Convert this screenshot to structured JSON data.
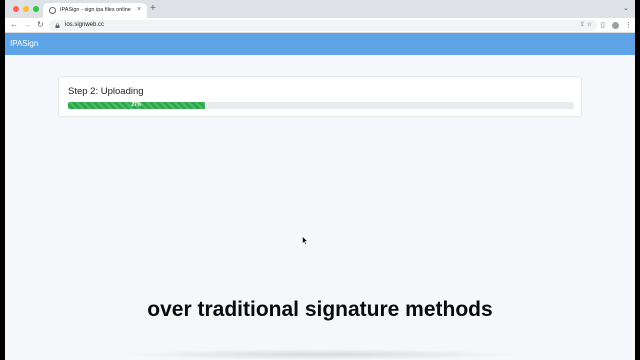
{
  "browser": {
    "tab_title": "IPASign - sign ipa files online",
    "tab_close": "×",
    "new_tab": "+",
    "tab_expand": "⌄",
    "url": "ios.signweb.cc",
    "nav": {
      "back": "←",
      "forward": "→",
      "reload": "↻"
    },
    "omnibox_icons": "⇪ ☆",
    "toolbar": {
      "side_panel": "▯",
      "menu": "⋮"
    }
  },
  "app": {
    "brand": "IPASign",
    "navbar_color": "#5ea3e6"
  },
  "upload": {
    "step_title": "Step 2: Uploading",
    "progress_percent": 27,
    "progress_label": "27%",
    "progress_color": "#28a745"
  },
  "caption": "over traditional signature methods"
}
